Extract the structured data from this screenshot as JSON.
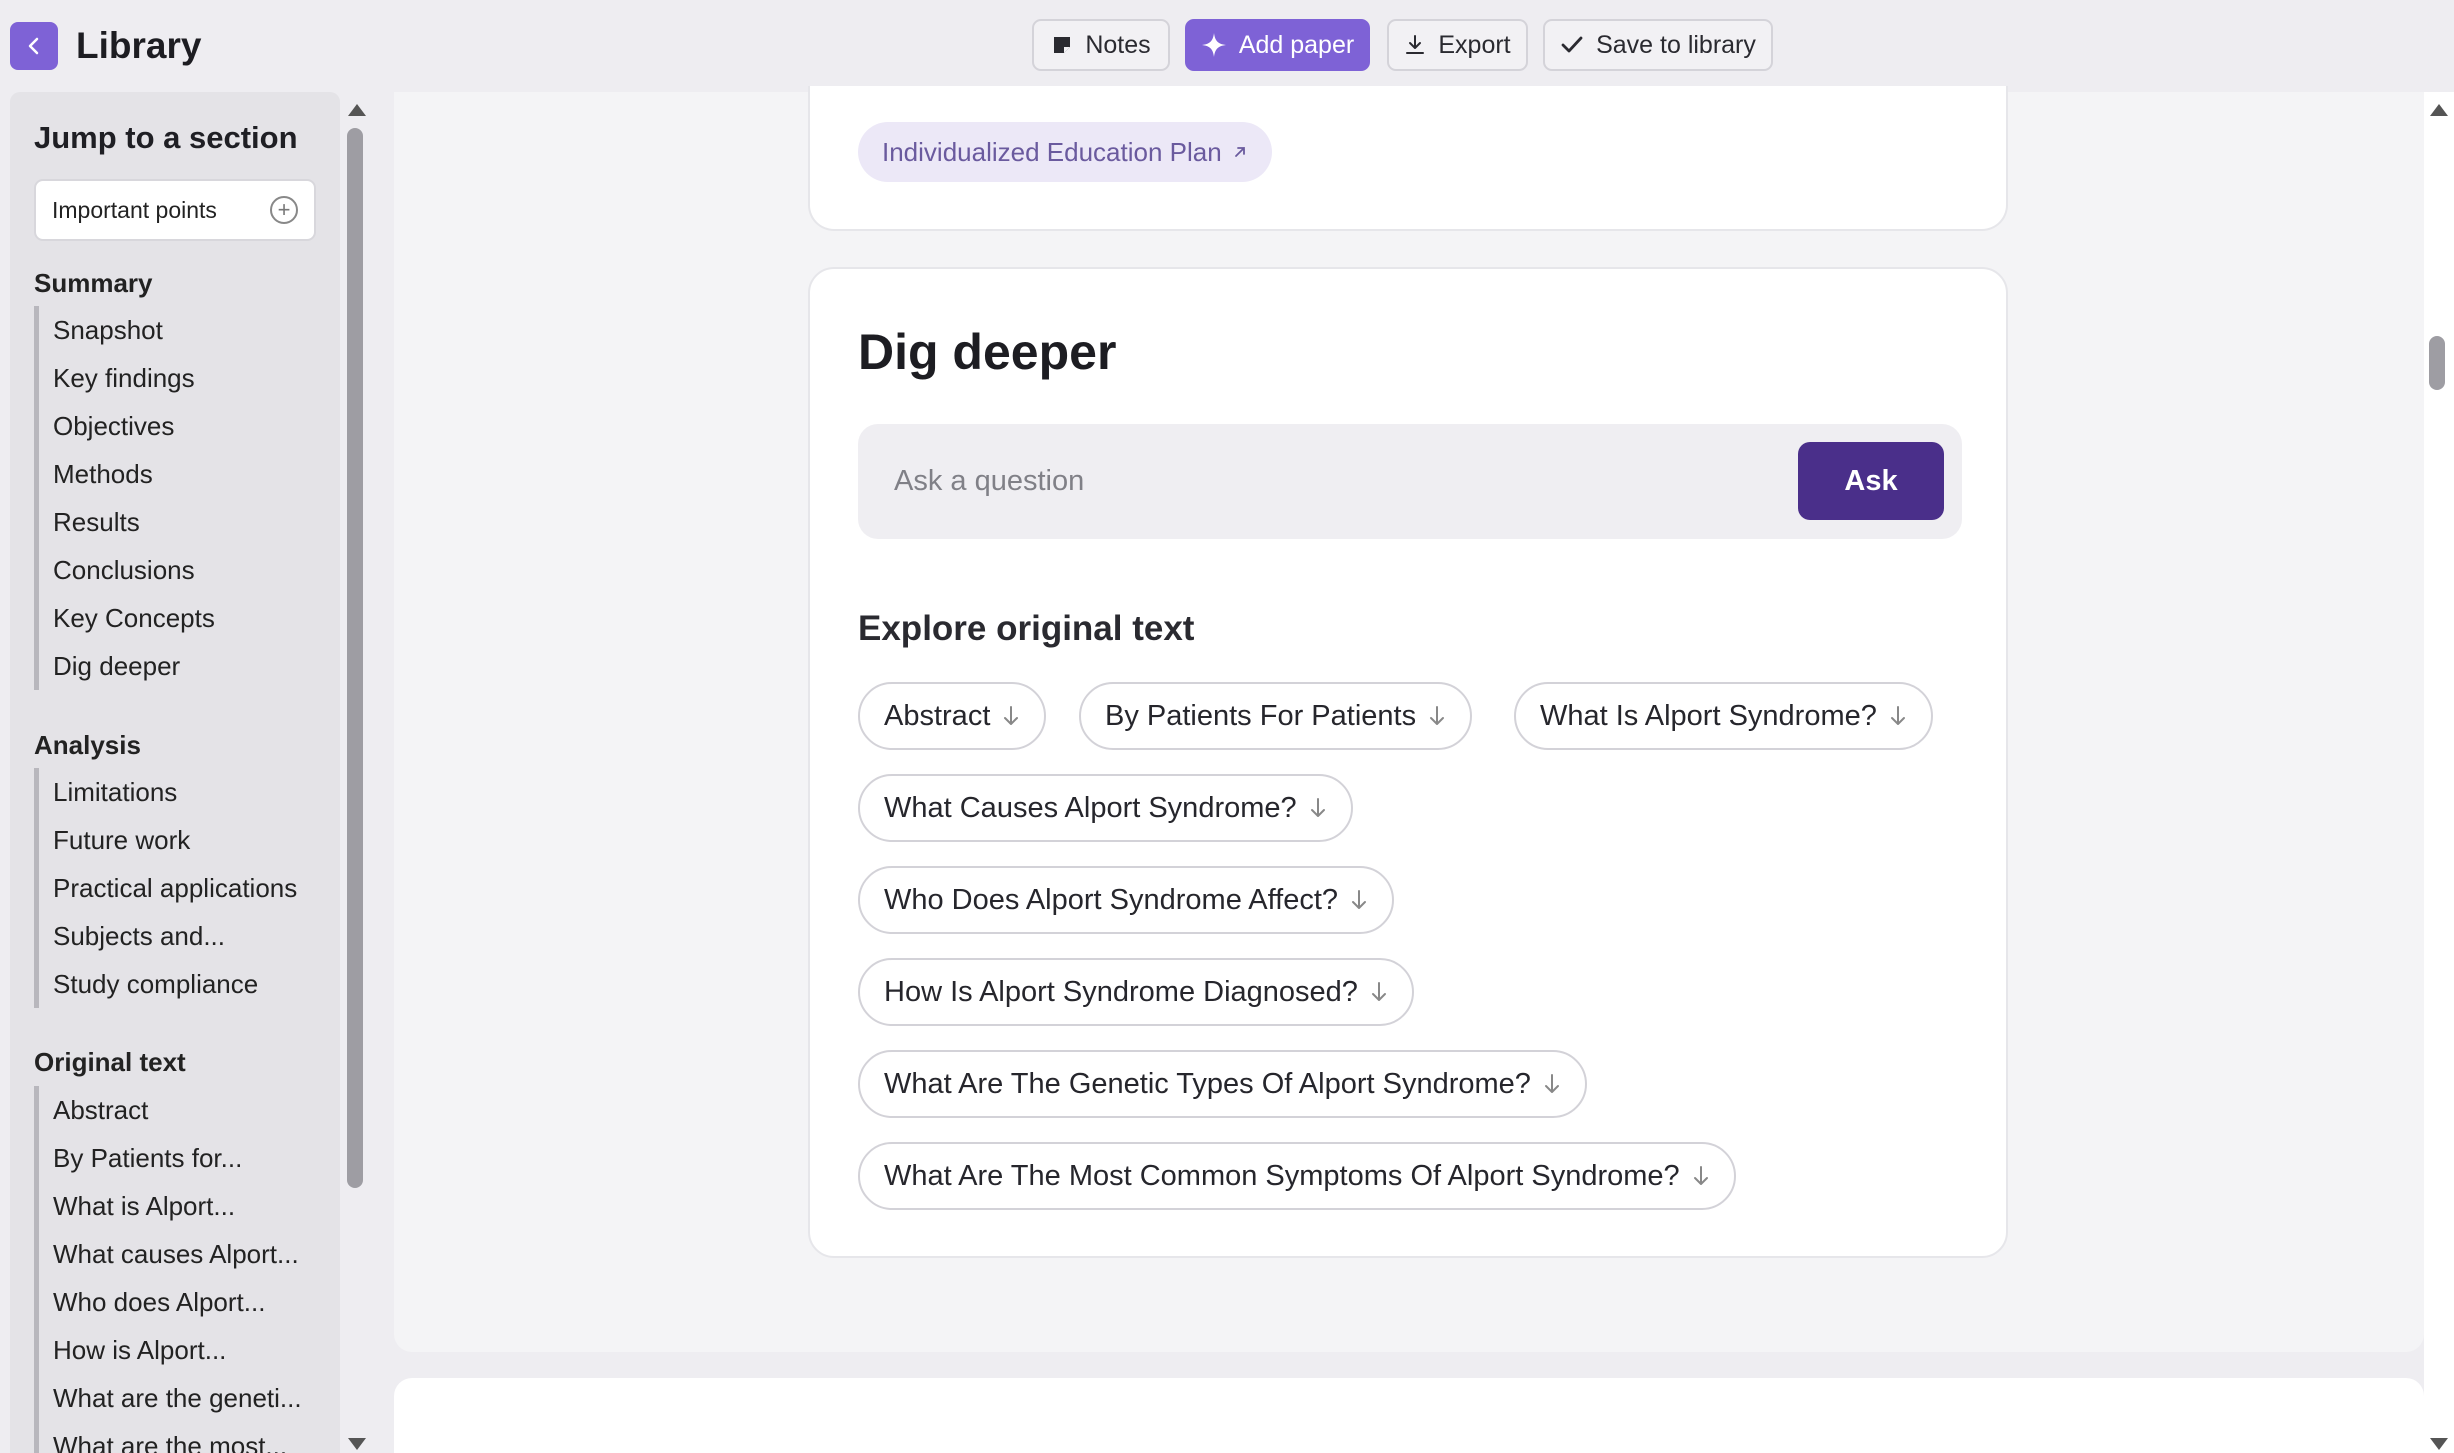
{
  "header": {
    "title": "Library",
    "back_icon": "chevron-left-icon"
  },
  "toolbar": {
    "notes_label": "Notes",
    "add_paper_label": "Add paper",
    "export_label": "Export",
    "save_label": "Save to library"
  },
  "sidebar": {
    "jump_title": "Jump to a section",
    "important_points": "Important points",
    "sections": [
      {
        "heading": "Summary",
        "items": [
          "Snapshot",
          "Key findings",
          "Objectives",
          "Methods",
          "Results",
          "Conclusions",
          "Key Concepts",
          "Dig deeper"
        ]
      },
      {
        "heading": "Analysis",
        "items": [
          "Limitations",
          "Future work",
          "Practical applications",
          "Subjects and...",
          "Study compliance"
        ]
      },
      {
        "heading": "Original text",
        "items": [
          "Abstract",
          "By Patients for...",
          "What is Alport...",
          "What causes Alport...",
          "Who does Alport...",
          "How is Alport...",
          "What are the geneti...",
          "What are the most..."
        ]
      }
    ]
  },
  "main": {
    "top_link": "Individualized Education Plan",
    "dig_title": "Dig deeper",
    "ask_placeholder": "Ask a question",
    "ask_button": "Ask",
    "explore_title": "Explore original text",
    "chips": [
      "Abstract",
      "By Patients For Patients",
      "What Is Alport Syndrome?",
      "What Causes Alport Syndrome?",
      "Who Does Alport Syndrome Affect?",
      "How Is Alport Syndrome Diagnosed?",
      "What Are The Genetic Types Of Alport Syndrome?",
      "What Are The Most Common Symptoms Of Alport Syndrome?"
    ]
  },
  "colors": {
    "accent": "#7e62d6",
    "ask_button": "#4a2f8a",
    "link_chip_bg": "#ece8f7",
    "link_chip_text": "#6a5a9e"
  }
}
